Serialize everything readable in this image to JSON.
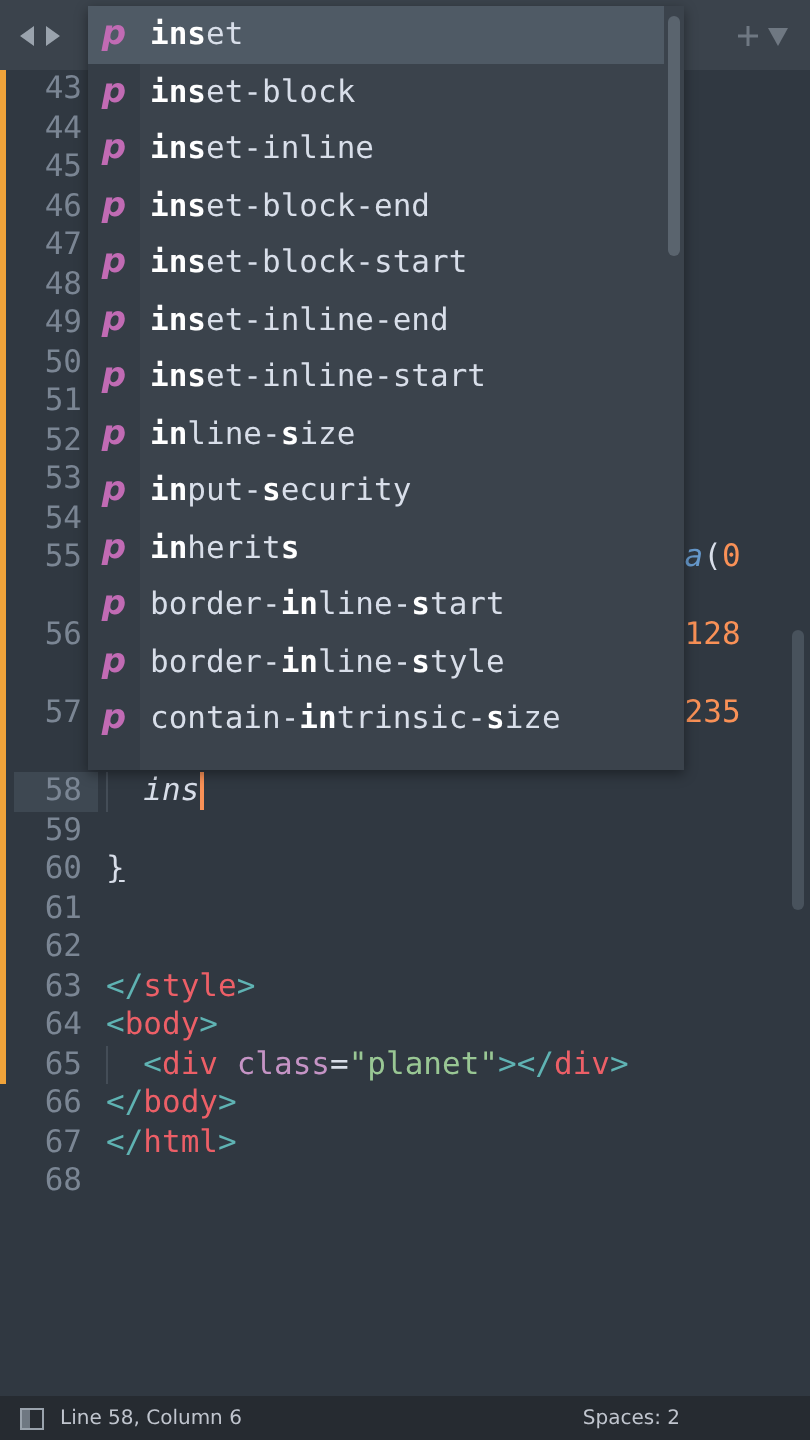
{
  "completions": [
    {
      "icon": "p",
      "label": "**ins**et",
      "selected": true
    },
    {
      "icon": "p",
      "label": "**ins**et-block",
      "selected": false
    },
    {
      "icon": "p",
      "label": "**ins**et-inline",
      "selected": false
    },
    {
      "icon": "p",
      "label": "**ins**et-block-end",
      "selected": false
    },
    {
      "icon": "p",
      "label": "**ins**et-block-start",
      "selected": false
    },
    {
      "icon": "p",
      "label": "**ins**et-inline-end",
      "selected": false
    },
    {
      "icon": "p",
      "label": "**ins**et-inline-start",
      "selected": false
    },
    {
      "icon": "p",
      "label": "**in**line-**s**ize",
      "selected": false
    },
    {
      "icon": "p",
      "label": "**in**put-**s**ecurity",
      "selected": false
    },
    {
      "icon": "p",
      "label": "**in**herit**s**",
      "selected": false
    },
    {
      "icon": "p",
      "label": "border-**in**line-**s**tart",
      "selected": false
    },
    {
      "icon": "p",
      "label": "border-**in**line-**s**tyle",
      "selected": false
    },
    {
      "icon": "p",
      "label": "contain-**in**trinsic-**s**ize",
      "selected": false
    }
  ],
  "lines": [
    {
      "number": "43",
      "modified": true
    },
    {
      "number": "44",
      "modified": true
    },
    {
      "number": "45",
      "modified": true
    },
    {
      "number": "46",
      "modified": true
    },
    {
      "number": "47",
      "modified": true
    },
    {
      "number": "48",
      "modified": true
    },
    {
      "number": "49",
      "modified": true
    },
    {
      "number": "50",
      "modified": true
    },
    {
      "number": "51",
      "modified": true
    },
    {
      "number": "52",
      "modified": true
    },
    {
      "number": "53",
      "modified": true
    },
    {
      "number": "54",
      "modified": true
    },
    {
      "number": "55",
      "modified": true,
      "wrapped": true,
      "tail": [
        {
          "kind": "function",
          "text": "a"
        },
        {
          "kind": "punct",
          "text": "("
        },
        {
          "kind": "number",
          "text": "0"
        }
      ]
    },
    {
      "number": "56",
      "modified": true,
      "wrapped": true,
      "tail": [
        {
          "kind": "number",
          "text": "128"
        }
      ]
    },
    {
      "number": "57",
      "modified": true,
      "wrapped": true,
      "tail": [
        {
          "kind": "number",
          "text": "235"
        }
      ]
    },
    {
      "number": "58",
      "modified": true,
      "current": true,
      "indented": true,
      "tokens": [
        {
          "kind": "typing",
          "text": "ins"
        }
      ]
    },
    {
      "number": "59",
      "modified": true
    },
    {
      "number": "60",
      "modified": true,
      "tokens": [
        {
          "kind": "brace",
          "text": "}"
        }
      ]
    },
    {
      "number": "61",
      "modified": true
    },
    {
      "number": "62",
      "modified": true
    },
    {
      "number": "63",
      "modified": true,
      "tokens": [
        {
          "kind": "bracket",
          "text": "</"
        },
        {
          "kind": "tag",
          "text": "style"
        },
        {
          "kind": "bracket",
          "text": ">"
        }
      ]
    },
    {
      "number": "64",
      "modified": true,
      "tokens": [
        {
          "kind": "bracket",
          "text": "<"
        },
        {
          "kind": "tag",
          "text": "body"
        },
        {
          "kind": "bracket",
          "text": ">"
        }
      ]
    },
    {
      "number": "65",
      "modified": true,
      "indented": true,
      "tokens": [
        {
          "kind": "bracket",
          "text": "<"
        },
        {
          "kind": "tag",
          "text": "div"
        },
        {
          "kind": "attr",
          "text": "class"
        },
        {
          "kind": "punct",
          "text": "="
        },
        {
          "kind": "string",
          "text": "\"planet\""
        },
        {
          "kind": "bracket",
          "text": "></"
        },
        {
          "kind": "tag",
          "text": "div"
        },
        {
          "kind": "bracket",
          "text": ">"
        }
      ]
    },
    {
      "number": "66",
      "modified": false,
      "tokens": [
        {
          "kind": "bracket",
          "text": "</"
        },
        {
          "kind": "tag",
          "text": "body"
        },
        {
          "kind": "bracket",
          "text": ">"
        }
      ]
    },
    {
      "number": "67",
      "modified": false,
      "tokens": [
        {
          "kind": "bracket",
          "text": "</"
        },
        {
          "kind": "tag",
          "text": "html"
        },
        {
          "kind": "bracket",
          "text": ">"
        }
      ]
    },
    {
      "number": "68",
      "modified": false
    }
  ],
  "status_bar": {
    "position": "Line 58, Column 6",
    "indentation": "Spaces: 2"
  }
}
